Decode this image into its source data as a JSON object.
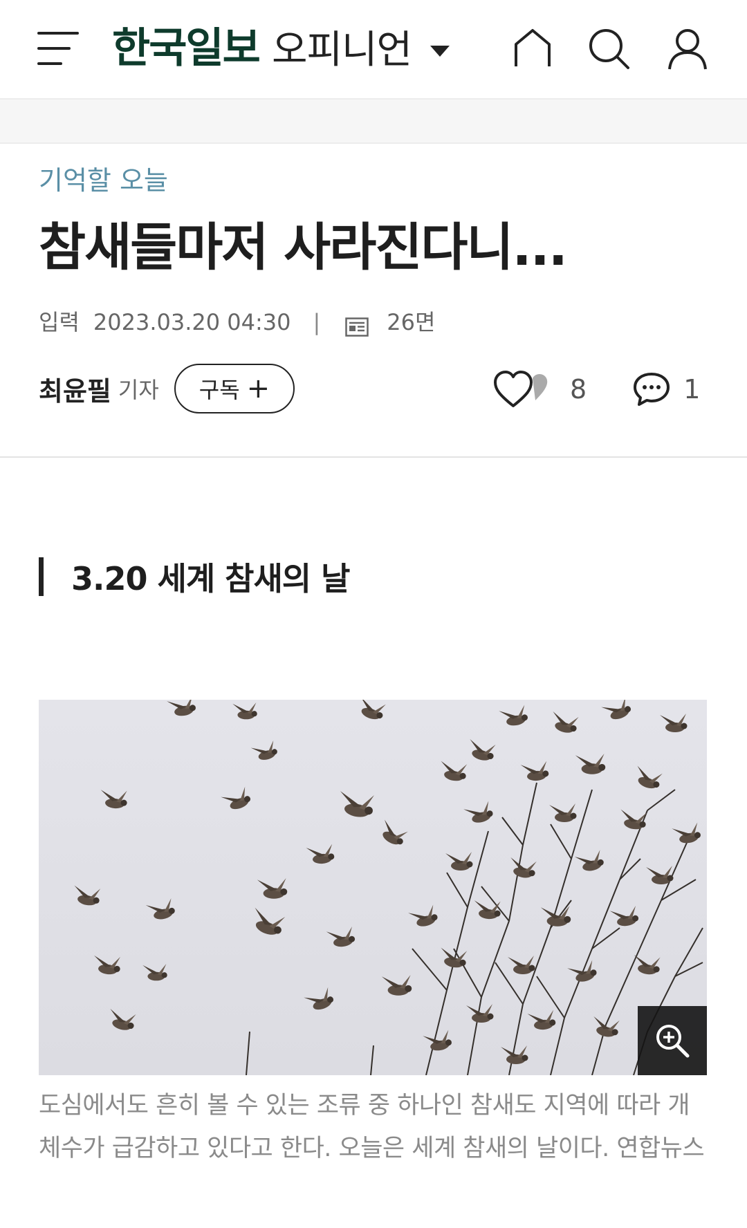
{
  "header": {
    "brand": "한국일보",
    "section": "오피니언",
    "icons": [
      "menu-icon",
      "home-icon",
      "search-icon",
      "user-icon"
    ]
  },
  "article": {
    "category": "기억할 오늘",
    "title": "참새들마저 사라진다니...",
    "meta": {
      "input_label": "입력",
      "datetime": "2023.03.20 04:30",
      "separator": "|",
      "page": "26면"
    },
    "author": {
      "name": "최윤필",
      "role": "기자",
      "subscribe_label": "구독",
      "subscribe_plus": "+"
    },
    "reactions": {
      "likes": "8",
      "comments": "1"
    },
    "subheading": "3.20 세계 참새의 날",
    "photo": {
      "caption": "도심에서도 흔히 볼 수 있는 조류 중 하나인 참새도 지역에 따라 개체수가 급감하고 있다고 한다. 오늘은 세계 참새의 날이다. 연합뉴스"
    }
  },
  "colors": {
    "brand": "#0e3b2c",
    "category": "#5a8fa6",
    "caption": "#8a8a8a"
  }
}
